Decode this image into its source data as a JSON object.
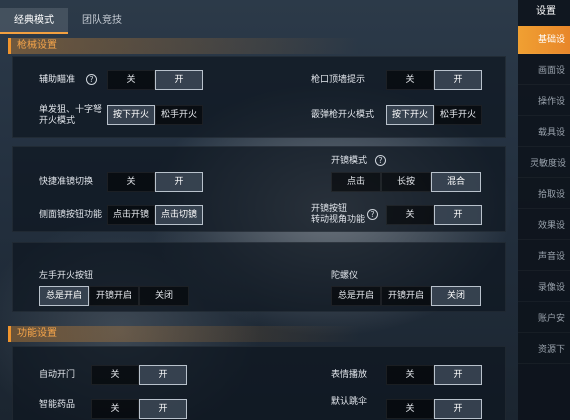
{
  "tabs": [
    {
      "label": "经典模式",
      "active": true
    },
    {
      "label": "团队竞技",
      "active": false
    }
  ],
  "sections": {
    "gun": "枪械设置",
    "func": "功能设置"
  },
  "gun_settings": {
    "aim_assist": {
      "label": "辅助瞄准",
      "options": [
        "关",
        "开"
      ],
      "selected": 1
    },
    "muzzle_hint": {
      "label": "枪口顶墙提示",
      "options": [
        "关",
        "开"
      ],
      "selected": 1
    },
    "single_fire": {
      "label_line1": "单发狙、十字弩",
      "label_line2": "开火模式",
      "options": [
        "按下开火",
        "松手开火"
      ],
      "selected": 0
    },
    "shotgun_fire": {
      "label": "霰弹枪开火模式",
      "options": [
        "按下开火",
        "松手开火"
      ],
      "selected": 0
    },
    "scope_mode": {
      "label": "开镜模式",
      "options": [
        "点击",
        "长按",
        "混合"
      ],
      "selected": 2
    },
    "quick_scope": {
      "label": "快捷准镜切换",
      "options": [
        "关",
        "开"
      ],
      "selected": 1
    },
    "side_scope": {
      "label": "侧面镜按钮功能",
      "options": [
        "点击开镜",
        "点击切镜"
      ],
      "selected": 1
    },
    "scope_btn_view": {
      "label_line1": "开镜按钮",
      "label_line2": "转动视角功能",
      "options": [
        "关",
        "开"
      ],
      "selected": 1
    },
    "left_fire": {
      "label": "左手开火按钮",
      "options": [
        "总是开启",
        "开镜开启",
        "关闭"
      ],
      "selected": 0
    },
    "gyro": {
      "label": "陀螺仪",
      "options": [
        "总是开启",
        "开镜开启",
        "关闭"
      ],
      "selected": 2
    }
  },
  "func_settings": {
    "auto_door": {
      "label": "自动开门",
      "options": [
        "关",
        "开"
      ],
      "selected": 1
    },
    "emote_play": {
      "label": "表情播放",
      "options": [
        "关",
        "开"
      ],
      "selected": 1
    },
    "smart_meds": {
      "label": "智能药品",
      "options": [
        "关",
        "开"
      ],
      "selected": 1
    },
    "default_jump": {
      "label_line1": "默认跳伞",
      "options": [
        "关",
        "开"
      ],
      "selected": 1
    }
  },
  "sidebar": {
    "title": "设置",
    "items": [
      {
        "label": "基础设",
        "active": true
      },
      {
        "label": "画面设",
        "active": false
      },
      {
        "label": "操作设",
        "active": false
      },
      {
        "label": "载具设",
        "active": false
      },
      {
        "label": "灵敏度设",
        "active": false
      },
      {
        "label": "拾取设",
        "active": false
      },
      {
        "label": "效果设",
        "active": false
      },
      {
        "label": "声音设",
        "active": false
      },
      {
        "label": "录像设",
        "active": false
      },
      {
        "label": "账户安",
        "active": false
      },
      {
        "label": "资源下",
        "active": false
      }
    ]
  },
  "colors": {
    "accent": "#f0952e",
    "selected_border": "#b9c2cc"
  }
}
